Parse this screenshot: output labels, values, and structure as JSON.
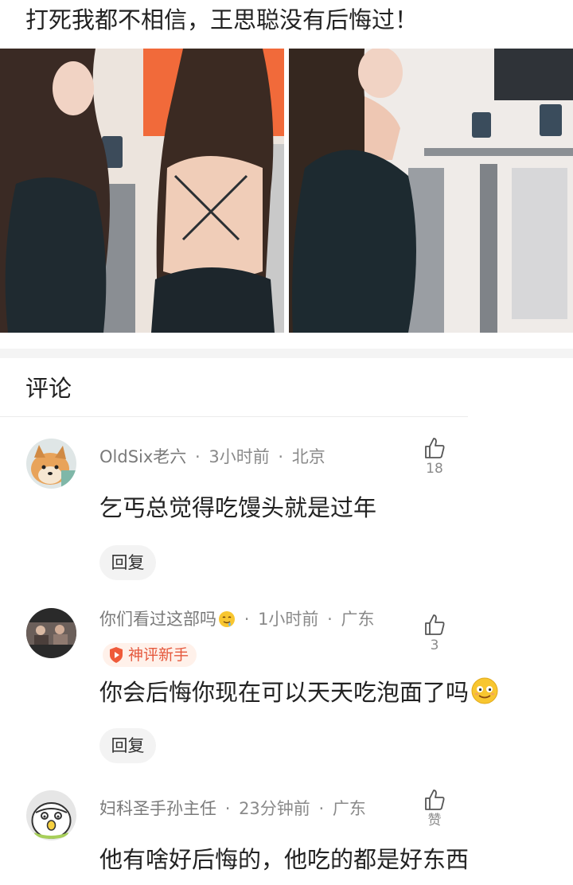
{
  "post": {
    "title": "打死我都不相信，王思聪没有后悔过！"
  },
  "comments_section": {
    "title": "评论"
  },
  "comments": [
    {
      "username": "OldSix老六",
      "time": "3小时前",
      "location": "北京",
      "text": "乞丐总觉得吃馒头就是过年",
      "likes": "18",
      "reply_label": "回复",
      "avatar_icon": "shiba-dog-avatar"
    },
    {
      "username": "你们看过这部吗",
      "username_emoji": "drooling-face-emoji",
      "time": "1小时前",
      "location": "广东",
      "badge": "神评新手",
      "text": "你会后悔你现在可以天天吃泡面了吗",
      "text_emoji": "smiling-face-emoji",
      "likes": "3",
      "reply_label": "回复",
      "avatar_icon": "movie-scene-avatar"
    },
    {
      "username": "妇科圣手孙主任",
      "time": "23分钟前",
      "location": "广东",
      "text": "他有啥好后悔的，他吃的都是好东西",
      "likes": "赞",
      "avatar_icon": "cartoon-bird-avatar"
    }
  ],
  "meta_separator": "·",
  "colors": {
    "text_primary": "#222222",
    "text_secondary": "#8a8a8a",
    "badge_text": "#e5583c",
    "badge_bg": "#fff1ea",
    "reply_bg": "#f3f3f3"
  }
}
